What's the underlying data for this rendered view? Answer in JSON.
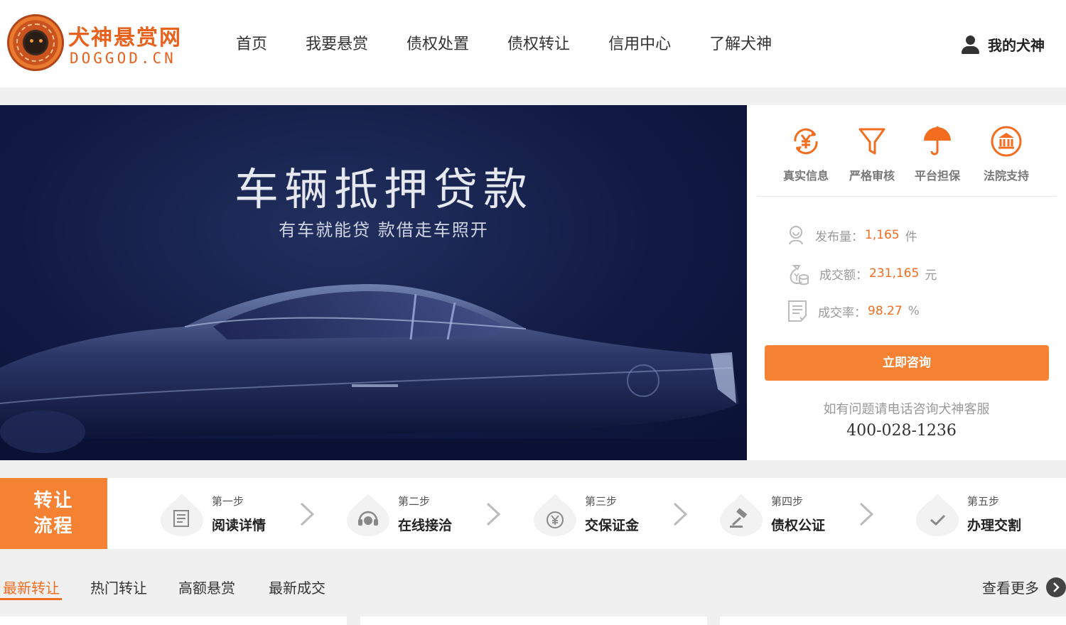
{
  "header": {
    "logo_title": "犬神悬赏网",
    "logo_sub": "DOGGOD.CN",
    "nav": [
      "首页",
      "我要悬赏",
      "债权处置",
      "债权转让",
      "信用中心",
      "了解犬神"
    ],
    "user_label": "我的犬神"
  },
  "banner": {
    "title": "车辆抵押贷款",
    "subtitle": "有车就能贷  款借走车照开"
  },
  "panel": {
    "features": [
      {
        "label": "真实信息",
        "icon": "yen-refresh-icon"
      },
      {
        "label": "严格审核",
        "icon": "funnel-icon"
      },
      {
        "label": "平台担保",
        "icon": "umbrella-icon"
      },
      {
        "label": "法院支持",
        "icon": "court-icon"
      }
    ],
    "stats": [
      {
        "label": "发布量：",
        "value": "1,165",
        "unit": "件",
        "icon": "user-badge-icon"
      },
      {
        "label": "成交额：",
        "value": "231,165",
        "unit": "元",
        "icon": "money-bag-icon"
      },
      {
        "label": "成交率：",
        "value": "98.27",
        "unit": "%",
        "icon": "document-icon"
      }
    ],
    "consult_button": "立即咨询",
    "help_text": "如有问题请电话咨询犬神客服",
    "phone": "400-028-1236"
  },
  "process": {
    "label_line1": "转让",
    "label_line2": "流程",
    "steps": [
      {
        "step": "第一步",
        "name": "阅读详情",
        "icon": "document-icon"
      },
      {
        "step": "第二步",
        "name": "在线接洽",
        "icon": "headset-icon"
      },
      {
        "step": "第三步",
        "name": "交保证金",
        "icon": "yen-coin-icon"
      },
      {
        "step": "第四步",
        "name": "债权公证",
        "icon": "gavel-icon"
      },
      {
        "step": "第五步",
        "name": "办理交割",
        "icon": "checkmark-icon"
      }
    ]
  },
  "tabs": {
    "items": [
      "最新转让",
      "热门转让",
      "高额悬赏",
      "最新成交"
    ],
    "active": "最新转让",
    "more_label": "查看更多"
  },
  "colors": {
    "accent": "#f58233",
    "accent_text": "#f36d21",
    "banner_bg": "#111a44"
  }
}
